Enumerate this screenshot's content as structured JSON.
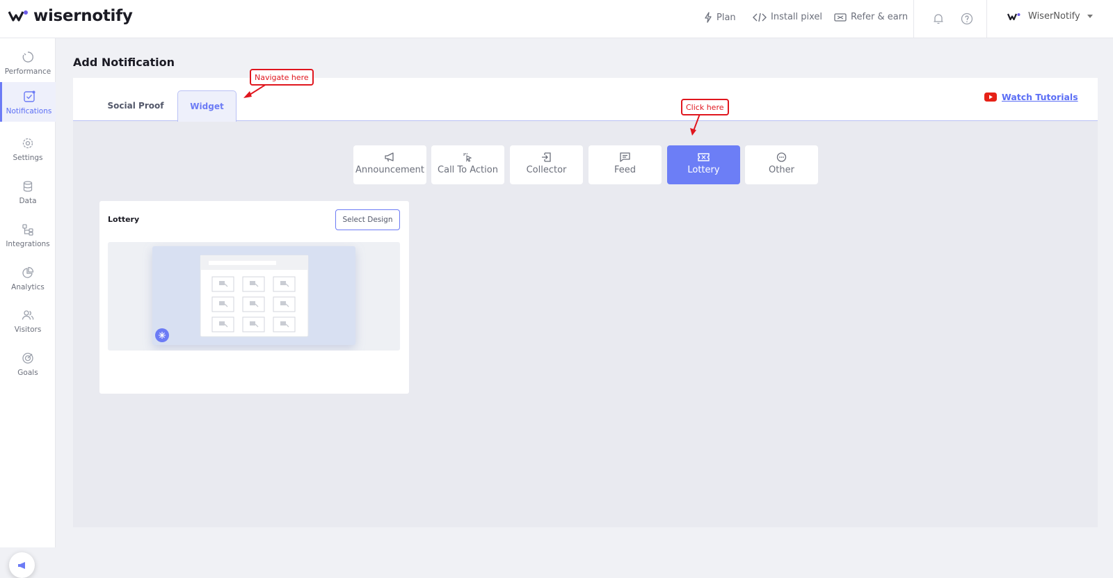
{
  "brand": {
    "name": "wisernotify"
  },
  "topnav": {
    "plan": "Plan",
    "install_pixel": "Install pixel",
    "refer_earn": "Refer & earn",
    "account_name": "WiserNotify"
  },
  "sidebar": {
    "items": [
      {
        "label": "Performance",
        "icon": "performance-icon"
      },
      {
        "label": "Notifications",
        "icon": "notifications-icon"
      },
      {
        "label": "Settings",
        "icon": "gear-icon"
      },
      {
        "label": "Data",
        "icon": "database-icon"
      },
      {
        "label": "Integrations",
        "icon": "integrations-icon"
      },
      {
        "label": "Analytics",
        "icon": "pie-chart-icon"
      },
      {
        "label": "Visitors",
        "icon": "users-icon"
      },
      {
        "label": "Goals",
        "icon": "target-icon"
      }
    ],
    "active": "Notifications"
  },
  "page": {
    "title": "Add Notification"
  },
  "tabs": [
    {
      "label": "Social Proof"
    },
    {
      "label": "Widget"
    }
  ],
  "active_tab": "Widget",
  "watch_tutorials": "Watch Tutorials",
  "categories": [
    {
      "label": "Announcement",
      "icon": "megaphone-icon"
    },
    {
      "label": "Call To Action",
      "icon": "click-icon"
    },
    {
      "label": "Collector",
      "icon": "collector-icon"
    },
    {
      "label": "Feed",
      "icon": "message-icon"
    },
    {
      "label": "Lottery",
      "icon": "ticket-icon"
    },
    {
      "label": "Other",
      "icon": "more-icon"
    }
  ],
  "active_category": "Lottery",
  "card": {
    "title": "Lottery",
    "select_button": "Select Design"
  },
  "annotations": {
    "navigate": "Navigate here",
    "click": "Click here"
  },
  "colors": {
    "accent": "#6c7ef6",
    "annotation": "#e0161e",
    "youtube": "#e62117"
  }
}
